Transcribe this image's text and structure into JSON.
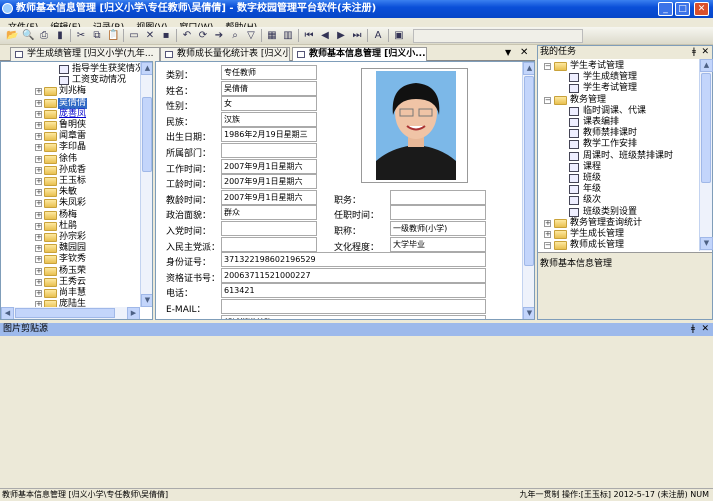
{
  "window": {
    "title": "教师基本信息管理 [归义小学\\专任教师\\吴倩倩] - 数字校园管理平台软件(未注册)"
  },
  "menu": [
    "文件(F)",
    "编辑(E)",
    "记录(R)",
    "视图(V)",
    "窗口(W)",
    "帮助(H)"
  ],
  "toolbar": {
    "icons": [
      "open-icon",
      "print-preview-icon",
      "print-icon",
      "delete-icon",
      "cut-icon",
      "copy-icon",
      "paste-icon",
      "new-icon",
      "delete-x-icon",
      "save-icon",
      "undo-icon",
      "refresh-icon",
      "goto-icon",
      "find-icon",
      "filter-icon",
      "filter2-icon",
      "grid-icon",
      "first-icon",
      "prev-icon",
      "next-icon",
      "last-icon",
      "font-icon",
      "calc-icon"
    ],
    "combo_value": ""
  },
  "tabs": [
    {
      "label": "学生成绩管理 [归义小学(九年..."
    },
    {
      "label": "教师成长量化统计表 [归义小..."
    },
    {
      "label": "教师基本信息管理 [归义小..."
    }
  ],
  "left_tree": {
    "items": [
      {
        "label": "指导学生获奖情况",
        "type": "doc"
      },
      {
        "label": "工资变动情况",
        "type": "doc"
      },
      {
        "label": "刘兆梅",
        "type": "folder"
      },
      {
        "label": "吴倩倩",
        "type": "folder",
        "selected": true
      },
      {
        "label": "庞善凤",
        "type": "folder",
        "link": true
      },
      {
        "label": "鲁明侠",
        "type": "folder"
      },
      {
        "label": "闻章雷",
        "type": "folder"
      },
      {
        "label": "李印晶",
        "type": "folder"
      },
      {
        "label": "徐伟",
        "type": "folder"
      },
      {
        "label": "孙成香",
        "type": "folder"
      },
      {
        "label": "王玉标",
        "type": "folder"
      },
      {
        "label": "朱敏",
        "type": "folder"
      },
      {
        "label": "朱凤彩",
        "type": "folder"
      },
      {
        "label": "杨梅",
        "type": "folder"
      },
      {
        "label": "杜鹃",
        "type": "folder"
      },
      {
        "label": "孙宗彩",
        "type": "folder"
      },
      {
        "label": "魏园园",
        "type": "folder"
      },
      {
        "label": "李钦秀",
        "type": "folder"
      },
      {
        "label": "杨玉荣",
        "type": "folder"
      },
      {
        "label": "王秀云",
        "type": "folder"
      },
      {
        "label": "尚丰慧",
        "type": "folder"
      },
      {
        "label": "庞陆生",
        "type": "folder"
      }
    ]
  },
  "form": {
    "left_fields": [
      {
        "label": "类别：",
        "value": "专任教师"
      },
      {
        "label": "姓名：",
        "value": "吴倩倩"
      },
      {
        "label": "性别：",
        "value": "女"
      },
      {
        "label": "民族：",
        "value": "汉族"
      },
      {
        "label": "出生日期：",
        "value": "1986年2月19日星期三"
      },
      {
        "label": "所属部门：",
        "value": ""
      },
      {
        "label": "工作时间：",
        "value": "2007年9月1日星期六"
      },
      {
        "label": "工龄时间：",
        "value": "2007年9月1日星期六"
      },
      {
        "label": "教龄时间：",
        "value": "2007年9月1日星期六"
      },
      {
        "label": "政治面貌：",
        "value": "群众"
      },
      {
        "label": "入党时间：",
        "value": ""
      },
      {
        "label": "入民主党派：",
        "value": ""
      }
    ],
    "right_fields": [
      {
        "label": "职务：",
        "value": ""
      },
      {
        "label": "任职时间：",
        "value": ""
      },
      {
        "label": "职称：",
        "value": "一级教师(小学)"
      },
      {
        "label": "文化程度：",
        "value": "大学毕业"
      }
    ],
    "wide_fields": [
      {
        "label": "身份证号：",
        "value": "371322198602196529"
      },
      {
        "label": "资格证书号：",
        "value": "20063711521000227"
      },
      {
        "label": "电话：",
        "value": "613421"
      },
      {
        "label": "E-MAIL：",
        "value": ""
      },
      {
        "label": "家庭住址：",
        "value": "郯城街道关路口"
      }
    ]
  },
  "right_panel": {
    "title": "我的任务",
    "items": [
      {
        "label": "学生考试管理",
        "type": "folder",
        "level": 0,
        "expanded": true
      },
      {
        "label": "学生成绩管理",
        "type": "doc",
        "level": 1
      },
      {
        "label": "学生考试管理",
        "type": "doc",
        "level": 1
      },
      {
        "label": "教务管理",
        "type": "folder",
        "level": 0,
        "expanded": true
      },
      {
        "label": "临时调课、代课",
        "type": "doc",
        "level": 1
      },
      {
        "label": "课表编排",
        "type": "doc",
        "level": 1
      },
      {
        "label": "教师禁排课时",
        "type": "doc",
        "level": 1
      },
      {
        "label": "教学工作安排",
        "type": "doc",
        "level": 1
      },
      {
        "label": "周课时、班级禁排课时",
        "type": "doc",
        "level": 1
      },
      {
        "label": "课程",
        "type": "doc",
        "level": 1
      },
      {
        "label": "班级",
        "type": "doc",
        "level": 1
      },
      {
        "label": "年级",
        "type": "doc",
        "level": 1
      },
      {
        "label": "级次",
        "type": "doc",
        "level": 1
      },
      {
        "label": "班级类别设置",
        "type": "doc",
        "level": 1
      },
      {
        "label": "教务管理查询统计",
        "type": "folder",
        "level": 0,
        "expanded": false
      },
      {
        "label": "学生成长管理",
        "type": "folder",
        "level": 0,
        "expanded": false
      },
      {
        "label": "教师成长管理",
        "type": "folder",
        "level": 0,
        "expanded": true
      }
    ],
    "description": "教师基本信息管理"
  },
  "bottom_panel": {
    "title": "图片剪贴源"
  },
  "status": {
    "left": "教师基本信息管理 [归义小学\\专任教师\\吴倩倩]",
    "right": "九年一贯制 操作:[王玉标] 2012-5-17 (未注册) NUM"
  },
  "colors": {
    "titlebar": "#0a4fd8",
    "selection": "#316ac5",
    "panel_header": "#9db9eb"
  }
}
